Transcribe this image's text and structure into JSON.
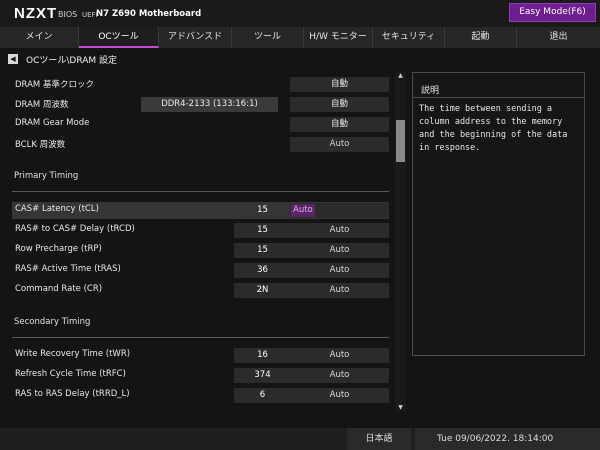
{
  "header": {
    "logo": "NZXT",
    "bios": "BIOS",
    "uefi": "UEFI",
    "model": "N7 Z690 Motherboard",
    "easy_mode": "Easy Mode(F6)",
    "accent_color": "#6e1e8f"
  },
  "tabs": [
    {
      "label": "メイン"
    },
    {
      "label": "OCツール"
    },
    {
      "label": "アドバンスド"
    },
    {
      "label": "ツール"
    },
    {
      "label": "H/W モニター"
    },
    {
      "label": "セキュリティ"
    },
    {
      "label": "起動"
    },
    {
      "label": "退出"
    }
  ],
  "active_tab": "OCツール",
  "breadcrumb": {
    "back_icon": "triangle-left-icon",
    "path": "OCツール\\DRAM 設定"
  },
  "dram": {
    "ref_clock": {
      "label": "DRAM 基準クロック",
      "value": "自動"
    },
    "frequency": {
      "label": "DRAM 周波数",
      "info": "DDR4-2133 (133:16:1)",
      "value": "自動"
    },
    "gear_mode": {
      "label": "DRAM Gear Mode",
      "value": "自動"
    },
    "bclk": {
      "label": "BCLK 周波数",
      "value": "Auto"
    }
  },
  "primary": {
    "title": "Primary Timing",
    "rows": [
      {
        "label": "CAS# Latency (tCL)",
        "num": "15",
        "value": "Auto"
      },
      {
        "label": "RAS# to CAS# Delay (tRCD)",
        "num": "15",
        "value": "Auto"
      },
      {
        "label": "Row Precharge (tRP)",
        "num": "15",
        "value": "Auto"
      },
      {
        "label": "RAS# Active Time (tRAS)",
        "num": "36",
        "value": "Auto"
      },
      {
        "label": "Command Rate (CR)",
        "num": "2N",
        "value": "Auto"
      }
    ]
  },
  "secondary": {
    "title": "Secondary Timing",
    "rows": [
      {
        "label": "Write Recovery Time (tWR)",
        "num": "16",
        "value": "Auto"
      },
      {
        "label": "Refresh Cycle Time (tRFC)",
        "num": "374",
        "value": "Auto"
      },
      {
        "label": "RAS to RAS Delay (tRRD_L)",
        "num": "6",
        "value": "Auto"
      }
    ]
  },
  "help": {
    "title": "説明",
    "text": "The time between sending a column address to the memory and the beginning of the data in response."
  },
  "footer": {
    "language": "日本語",
    "datetime": "Tue 09/06/2022. 18:14:00"
  }
}
